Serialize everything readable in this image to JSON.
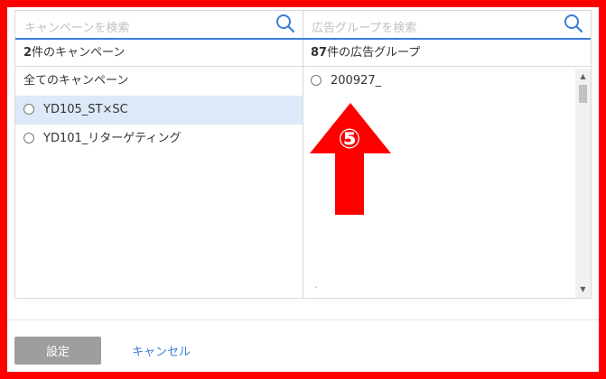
{
  "campaign_panel": {
    "search_placeholder": "キャンペーンを検索",
    "count_number": "2",
    "count_suffix": "件のキャンペーン",
    "all_label": "全てのキャンペーン",
    "items": [
      {
        "label": "YD105_ST×SC",
        "selected": true
      },
      {
        "label": "YD101_リターゲティング",
        "selected": false
      }
    ]
  },
  "adgroup_panel": {
    "search_placeholder": "広告グループを検索",
    "count_number": "87",
    "count_suffix": "件の広告グループ",
    "items": [
      {
        "label": "200927_"
      }
    ],
    "trailing_mark": "-"
  },
  "annotation": {
    "number_glyph": "⑤",
    "color": "#ff0000"
  },
  "footer": {
    "submit_label": "設定",
    "cancel_label": "キャンセル"
  },
  "colors": {
    "accent": "#3b7dd8",
    "selected_row": "#dde9f8",
    "frame": "#ff0000"
  }
}
